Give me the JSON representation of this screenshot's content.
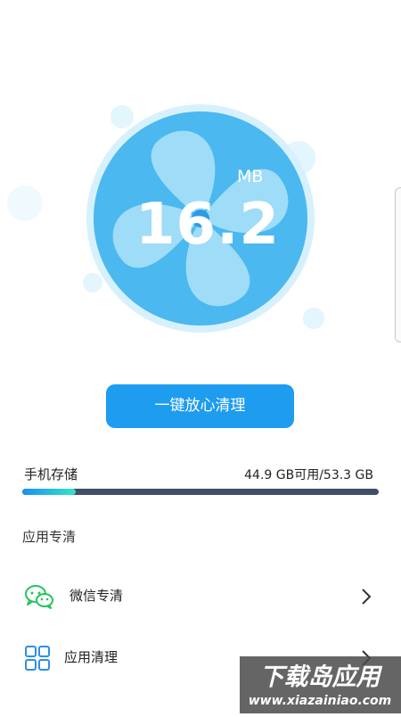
{
  "hero": {
    "junk_size_value": "16.2",
    "junk_size_unit": "MB"
  },
  "clean_button_label": "一键放心清理",
  "storage": {
    "label": "手机存储",
    "value_text": "44.9 GB可用/53.3 GB",
    "available_gb": 44.9,
    "total_gb": 53.3,
    "bar_fill_fraction": 0.15
  },
  "app_section": {
    "title": "应用专清",
    "items": [
      {
        "label": "微信专清",
        "icon": "wechat-icon"
      },
      {
        "label": "应用清理",
        "icon": "app-grid-icon"
      }
    ]
  },
  "watermark": {
    "title": "下载岛应用",
    "url": "www.xiazainiao.com"
  },
  "colors": {
    "accent": "#1e9cf0",
    "fan_blue": "#4bb8ef",
    "fan_blade": "#9edcf8",
    "progress_track": "#414f6b",
    "progress_fill_start": "#1a8ff0",
    "progress_fill_end": "#35e4c4",
    "wechat_green": "#22c55e",
    "grid_blue": "#2f8fe8"
  }
}
